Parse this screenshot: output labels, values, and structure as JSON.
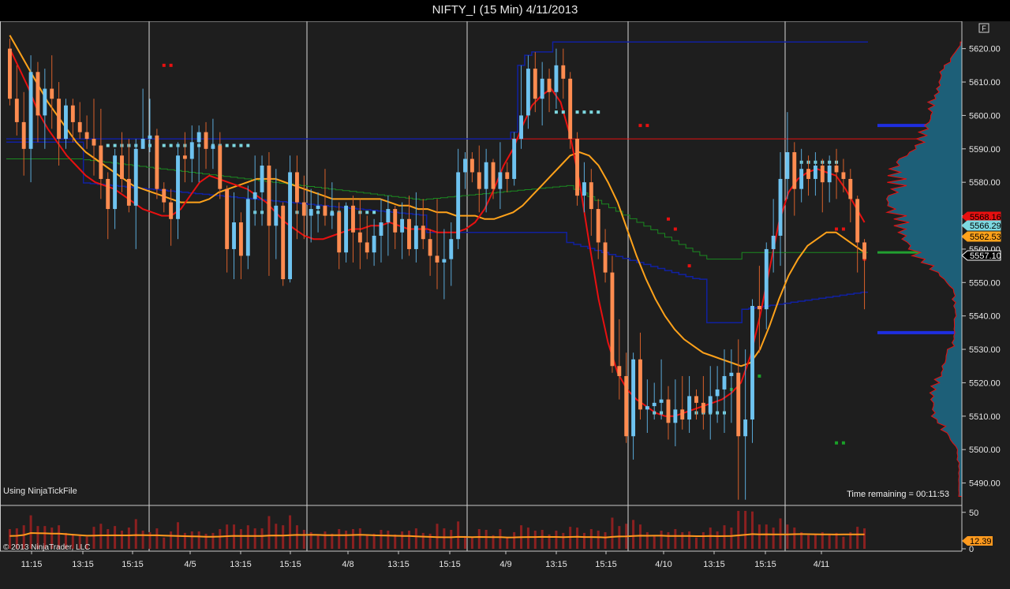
{
  "window": {
    "title": "NIFTY_I (15 Min)  4/11/2013"
  },
  "overlay": {
    "source_note": "Using NinjaTickFile",
    "time_remaining": "Time remaining = 00:11:53",
    "copyright": "© 2013 NinjaTrader, LLC",
    "f_box": "F"
  },
  "colors": {
    "background": "#1e1e1e",
    "up_candle": "#6ec3f0",
    "down_candle": "#ff8c50",
    "fast_ma": "#e81010",
    "slow_ma": "#ffa21a",
    "vwap_high": "#1020a0",
    "vwap_mid": "#1a8a20",
    "dots_cyan": "#7dd8e0",
    "volume_bar": "#8c2020",
    "volume_ma": "#ff9a1e",
    "profile_fill": "#1d5f78",
    "profile_edge": "#e81010"
  },
  "chart_data": {
    "type": "candlestick",
    "symbol": "NIFTY_I",
    "interval": "15 Min",
    "x_tick_labels": [
      "11:15",
      "13:15",
      "15:15",
      "4/5",
      "13:15",
      "15:15",
      "4/8",
      "13:15",
      "15:15",
      "4/9",
      "13:15",
      "15:15",
      "4/10",
      "13:15",
      "15:15",
      "4/11"
    ],
    "price_axis": {
      "range": [
        5484,
        5627
      ],
      "ticks": [
        5490,
        5500,
        5510,
        5520,
        5530,
        5540,
        5550,
        5560,
        5570,
        5580,
        5590,
        5600,
        5610,
        5620
      ]
    },
    "volume_axis": {
      "range": [
        0,
        53
      ],
      "ticks": [
        0,
        50
      ]
    },
    "price_labels": [
      {
        "label": "5568.16",
        "value": 5568.16,
        "color": "#e81010"
      },
      {
        "label": "5566.29",
        "value": 5566.29,
        "color": "#7dd8e0"
      },
      {
        "label": "5562.53",
        "value": 5562.53,
        "color": "#ffa21a"
      },
      {
        "label": "5557.10",
        "value": 5557.1,
        "color": "#ffffff"
      }
    ],
    "volume_label": {
      "label": "12.39",
      "value": 12.39
    },
    "levels": {
      "red_line": 5593,
      "blue_level_upper": 5597,
      "blue_level_lower": 5535,
      "green_level": 5559
    },
    "candles": [
      [
        5620,
        5623,
        5603,
        5605
      ],
      [
        5605,
        5615,
        5594,
        5598
      ],
      [
        5598,
        5607,
        5582,
        5590
      ],
      [
        5590,
        5618,
        5580,
        5613
      ],
      [
        5613,
        5616,
        5592,
        5600
      ],
      [
        5600,
        5614,
        5590,
        5608
      ],
      [
        5608,
        5618,
        5596,
        5605
      ],
      [
        5605,
        5610,
        5585,
        5593
      ],
      [
        5593,
        5605,
        5590,
        5603
      ],
      [
        5603,
        5605,
        5592,
        5598
      ],
      [
        5598,
        5604,
        5593,
        5595
      ],
      [
        5595,
        5600,
        5590,
        5593
      ],
      [
        5593,
        5605,
        5582,
        5591
      ],
      [
        5591,
        5602,
        5575,
        5581
      ],
      [
        5581,
        5583,
        5563,
        5572
      ],
      [
        5572,
        5590,
        5566,
        5588
      ],
      [
        5588,
        5595,
        5577,
        5581
      ],
      [
        5581,
        5593,
        5571,
        5573
      ],
      [
        5573,
        5593,
        5560,
        5590
      ],
      [
        5590,
        5608,
        5590,
        5593
      ],
      [
        5593,
        5605,
        5589,
        5594
      ],
      [
        5594,
        5596,
        5575,
        5578
      ],
      [
        5578,
        5580,
        5571,
        5574
      ],
      [
        5574,
        5578,
        5561,
        5569
      ],
      [
        5569,
        5592,
        5563,
        5588
      ],
      [
        5588,
        5595,
        5580,
        5587
      ],
      [
        5587,
        5597,
        5580,
        5592
      ],
      [
        5592,
        5597,
        5580,
        5595
      ],
      [
        5595,
        5598,
        5584,
        5590
      ],
      [
        5590,
        5599,
        5584,
        5591
      ],
      [
        5591,
        5595,
        5575,
        5578
      ],
      [
        5578,
        5579,
        5553,
        5560
      ],
      [
        5560,
        5577,
        5551,
        5568
      ],
      [
        5568,
        5571,
        5551,
        5558
      ],
      [
        5558,
        5579,
        5554,
        5575
      ],
      [
        5575,
        5588,
        5567,
        5577
      ],
      [
        5577,
        5588,
        5567,
        5585
      ],
      [
        5585,
        5589,
        5552,
        5567
      ],
      [
        5567,
        5584,
        5557,
        5573
      ],
      [
        5573,
        5574,
        5549,
        5551
      ],
      [
        5551,
        5588,
        5550,
        5583
      ],
      [
        5583,
        5588,
        5563,
        5574
      ],
      [
        5574,
        5582,
        5563,
        5570
      ],
      [
        5570,
        5578,
        5562,
        5572
      ],
      [
        5572,
        5577,
        5565,
        5573
      ],
      [
        5573,
        5584,
        5567,
        5570
      ],
      [
        5570,
        5580,
        5566,
        5571
      ],
      [
        5571,
        5574,
        5554,
        5559
      ],
      [
        5559,
        5574,
        5556,
        5573
      ],
      [
        5573,
        5576,
        5556,
        5565
      ],
      [
        5565,
        5575,
        5554,
        5562
      ],
      [
        5562,
        5570,
        5557,
        5559
      ],
      [
        5559,
        5569,
        5555,
        5564
      ],
      [
        5564,
        5575,
        5556,
        5568
      ],
      [
        5568,
        5576,
        5558,
        5572
      ],
      [
        5572,
        5573,
        5560,
        5565
      ],
      [
        5565,
        5574,
        5557,
        5569
      ],
      [
        5569,
        5576,
        5558,
        5560
      ],
      [
        5560,
        5577,
        5556,
        5567
      ],
      [
        5567,
        5575,
        5560,
        5563
      ],
      [
        5563,
        5566,
        5552,
        5558
      ],
      [
        5558,
        5575,
        5548,
        5556
      ],
      [
        5556,
        5566,
        5545,
        5557
      ],
      [
        5557,
        5568,
        5549,
        5563
      ],
      [
        5563,
        5590,
        5560,
        5583
      ],
      [
        5583,
        5589,
        5578,
        5587
      ],
      [
        5587,
        5589,
        5580,
        5583
      ],
      [
        5583,
        5591,
        5571,
        5578
      ],
      [
        5578,
        5590,
        5571,
        5586
      ],
      [
        5586,
        5587,
        5575,
        5578
      ],
      [
        5578,
        5592,
        5572,
        5583
      ],
      [
        5583,
        5586,
        5577,
        5581
      ],
      [
        5581,
        5595,
        5579,
        5593
      ],
      [
        5593,
        5615,
        5590,
        5600
      ],
      [
        5600,
        5618,
        5596,
        5614
      ],
      [
        5614,
        5619,
        5601,
        5605
      ],
      [
        5605,
        5616,
        5597,
        5611
      ],
      [
        5611,
        5614,
        5601,
        5607
      ],
      [
        5607,
        5620,
        5602,
        5615
      ],
      [
        5615,
        5620,
        5605,
        5611
      ],
      [
        5611,
        5613,
        5590,
        5593
      ],
      [
        5593,
        5595,
        5573,
        5576
      ],
      [
        5576,
        5586,
        5571,
        5580
      ],
      [
        5580,
        5584,
        5564,
        5572
      ],
      [
        5572,
        5575,
        5557,
        5562
      ],
      [
        5562,
        5566,
        5550,
        5553
      ],
      [
        5553,
        5558,
        5523,
        5525
      ],
      [
        5525,
        5539,
        5515,
        5522
      ],
      [
        5522,
        5529,
        5502,
        5504
      ],
      [
        5504,
        5529,
        5497,
        5527
      ],
      [
        5527,
        5535,
        5509,
        5512
      ],
      [
        5512,
        5521,
        5505,
        5513
      ],
      [
        5513,
        5520,
        5509,
        5514
      ],
      [
        5514,
        5527,
        5509,
        5515
      ],
      [
        5515,
        5519,
        5503,
        5508
      ],
      [
        5508,
        5521,
        5501,
        5512
      ],
      [
        5512,
        5522,
        5506,
        5509
      ],
      [
        5509,
        5522,
        5505,
        5516
      ],
      [
        5516,
        5518,
        5509,
        5514
      ],
      [
        5514,
        5522,
        5506,
        5511
      ],
      [
        5511,
        5525,
        5503,
        5516
      ],
      [
        5516,
        5525,
        5508,
        5518
      ],
      [
        5518,
        5530,
        5505,
        5522
      ],
      [
        5522,
        5530,
        5508,
        5523
      ],
      [
        5523,
        5533,
        5485,
        5504
      ],
      [
        5504,
        5530,
        5485,
        5509
      ],
      [
        5509,
        5545,
        5502,
        5543
      ],
      [
        5543,
        5555,
        5529,
        5542
      ],
      [
        5542,
        5562,
        5536,
        5560
      ],
      [
        5560,
        5575,
        5553,
        5564
      ],
      [
        5564,
        5589,
        5555,
        5581
      ],
      [
        5581,
        5601,
        5575,
        5589
      ],
      [
        5589,
        5592,
        5570,
        5578
      ],
      [
        5578,
        5590,
        5574,
        5584
      ],
      [
        5584,
        5588,
        5576,
        5581
      ],
      [
        5581,
        5589,
        5576,
        5585
      ],
      [
        5585,
        5587,
        5571,
        5580
      ],
      [
        5580,
        5588,
        5574,
        5585
      ],
      [
        5585,
        5590,
        5575,
        5583
      ],
      [
        5583,
        5587,
        5577,
        5581
      ],
      [
        5581,
        5584,
        5568,
        5575
      ],
      [
        5575,
        5576,
        5553,
        5562
      ],
      [
        5562,
        5563,
        5542,
        5557
      ]
    ],
    "fast_ma": [
      5620,
      5614,
      5608,
      5601,
      5596,
      5592,
      5588,
      5585,
      5582,
      5580,
      5579,
      5578,
      5576,
      5574,
      5572,
      5571,
      5570,
      5570,
      5572,
      5576,
      5580,
      5582,
      5581,
      5580,
      5579,
      5578,
      5576,
      5574,
      5571,
      5568,
      5566,
      5564,
      5563,
      5563,
      5564,
      5565,
      5566,
      5566,
      5567,
      5567,
      5568,
      5567,
      5566,
      5566,
      5566,
      5565,
      5565,
      5565,
      5566,
      5568,
      5572,
      5578,
      5585,
      5590,
      5597,
      5603,
      5606,
      5608,
      5604,
      5594,
      5580,
      5562,
      5545,
      5532,
      5523,
      5518,
      5515,
      5513,
      5511,
      5510,
      5510,
      5511,
      5512,
      5513,
      5514,
      5515,
      5517,
      5520,
      5528,
      5540,
      5554,
      5568,
      5577,
      5581,
      5583,
      5584,
      5583,
      5582,
      5578,
      5573,
      5568
    ],
    "slow_ma": [
      5624,
      5619,
      5614,
      5609,
      5604,
      5600,
      5596,
      5592,
      5589,
      5587,
      5585,
      5583,
      5581,
      5579,
      5578,
      5577,
      5576,
      5575,
      5574,
      5574,
      5574,
      5575,
      5577,
      5578,
      5579,
      5580,
      5581,
      5581,
      5581,
      5580,
      5579,
      5578,
      5577,
      5576,
      5575,
      5575,
      5575,
      5575,
      5575,
      5575,
      5574,
      5573,
      5573,
      5572,
      5572,
      5571,
      5571,
      5570,
      5570,
      5570,
      5569,
      5569,
      5570,
      5571,
      5573,
      5576,
      5579,
      5582,
      5585,
      5588,
      5589,
      5588,
      5585,
      5580,
      5574,
      5566,
      5558,
      5551,
      5545,
      5540,
      5536,
      5533,
      5531,
      5529,
      5528,
      5527,
      5526,
      5525,
      5526,
      5530,
      5537,
      5545,
      5552,
      5557,
      5561,
      5563,
      5565,
      5565,
      5563,
      5561,
      5559
    ]
  }
}
